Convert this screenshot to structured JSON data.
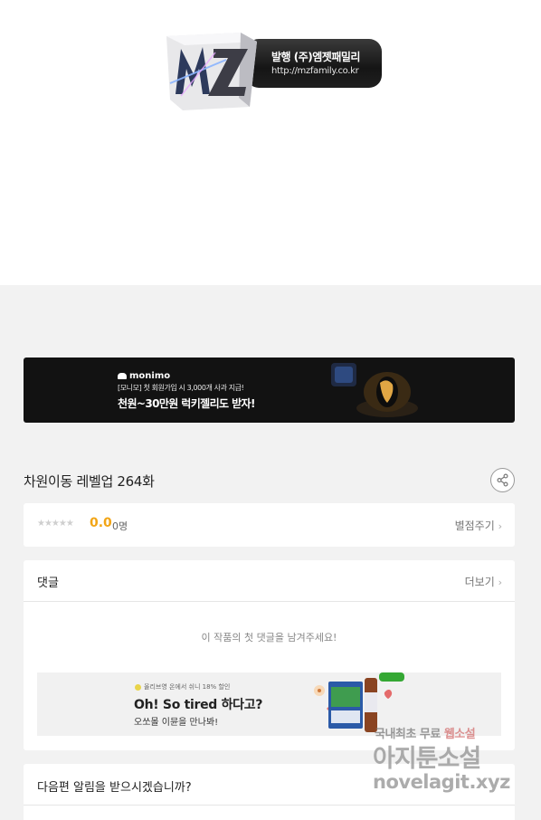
{
  "publisher_logo": {
    "logo_mark": "MZ",
    "publisher": "발행 (주)엠젯패밀리",
    "url": "http://mzfamily.co.kr"
  },
  "ad_banner_top": {
    "brand": "monimo",
    "subline": "[모니모] 첫 회원가입 시 3,000개 사과 지급!",
    "headline": "천원~30만원 럭키젤리도 받자!"
  },
  "episode": {
    "title": "차원이동 레벨업 264화"
  },
  "rating": {
    "stars": "★★★★★",
    "score": "0.0",
    "count": "0명",
    "rate_link": "별점주기"
  },
  "comments": {
    "title": "댓글",
    "more": "더보기",
    "empty_message": "이 작품의 첫 댓글을 남겨주세요!"
  },
  "ad_banner_comments": {
    "tag": "올리브영 온에서 쉬니 18% 할인",
    "headline": "Oh! So tired 하다고?",
    "subline": "오쏘몰 이뮨을 만나봐!"
  },
  "notification": {
    "question": "다음편 알림을 받으시겠습니까?"
  },
  "watermark": {
    "line1_prefix": "국내최초 무료",
    "line1_highlight": "웹소설",
    "line2": "아지툰소설",
    "line3": "novelagit.xyz"
  },
  "icons": {
    "share": "share-icon",
    "chevron": "chevron-right-icon"
  },
  "colors": {
    "score_accent": "#f2a516",
    "page_bg": "#f2f2f2",
    "banner_dark": "#121212"
  }
}
